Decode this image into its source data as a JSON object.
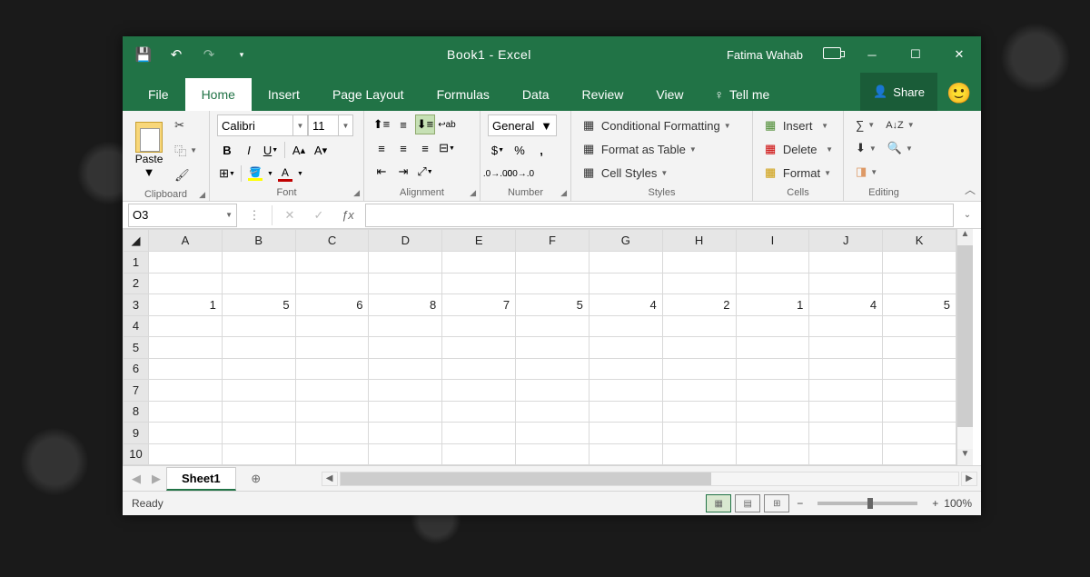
{
  "title": "Book1  -  Excel",
  "user": "Fatima Wahab",
  "quick_access": {
    "save": "💾",
    "undo": "↶",
    "redo": "↷",
    "custom": "▾"
  },
  "tabs": [
    "File",
    "Home",
    "Insert",
    "Page Layout",
    "Formulas",
    "Data",
    "Review",
    "View"
  ],
  "active_tab": "Home",
  "tellme": "Tell me",
  "share": "Share",
  "ribbon": {
    "clipboard": {
      "paste": "Paste",
      "label": "Clipboard"
    },
    "font": {
      "name": "Calibri",
      "size": "11",
      "label": "Font"
    },
    "alignment": {
      "label": "Alignment"
    },
    "number": {
      "format": "General",
      "label": "Number"
    },
    "styles": {
      "cond": "Conditional Formatting",
      "table": "Format as Table",
      "cell": "Cell Styles",
      "label": "Styles"
    },
    "cells": {
      "insert": "Insert",
      "delete": "Delete",
      "format": "Format",
      "label": "Cells"
    },
    "editing": {
      "label": "Editing"
    }
  },
  "namebox": "O3",
  "columns": [
    "A",
    "B",
    "C",
    "D",
    "E",
    "F",
    "G",
    "H",
    "I",
    "J",
    "K"
  ],
  "rows": [
    "1",
    "2",
    "3",
    "4",
    "5",
    "6",
    "7",
    "8",
    "9",
    "10"
  ],
  "data_row": {
    "A": "1",
    "B": "5",
    "C": "6",
    "D": "8",
    "E": "7",
    "F": "5",
    "G": "4",
    "H": "2",
    "I": "1",
    "J": "4",
    "K": "5"
  },
  "sheet": "Sheet1",
  "status_text": "Ready",
  "zoom": "100%"
}
